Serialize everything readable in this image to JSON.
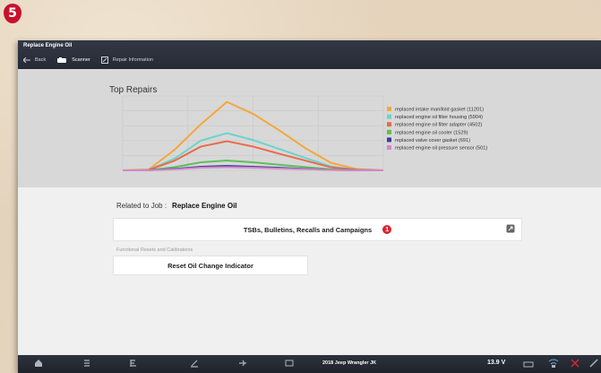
{
  "step_badge": "5",
  "window_title": "Replace Engine Oil",
  "nav": {
    "back_label": "Back",
    "scanner_label": "Scanner",
    "repair_info_label": "Repair Information"
  },
  "chart_data": {
    "type": "line",
    "title": "Top Repairs",
    "x": [
      1,
      2,
      3,
      4,
      5,
      6,
      7,
      8,
      9,
      10,
      11
    ],
    "ylim": [
      0,
      2500
    ],
    "grid": true,
    "legend_position": "right",
    "series": [
      {
        "name": "replaced intake manifold gasket (11201)",
        "color": "#f3a73b",
        "values": [
          0,
          30,
          700,
          1550,
          2300,
          1900,
          1350,
          750,
          250,
          40,
          0
        ]
      },
      {
        "name": "replaced engine oil filter housing (5904)",
        "color": "#6cd3cc",
        "values": [
          0,
          15,
          400,
          1000,
          1250,
          1020,
          720,
          420,
          130,
          20,
          0
        ]
      },
      {
        "name": "replaced engine oil filter adapter (4502)",
        "color": "#ea6a4a",
        "values": [
          0,
          12,
          330,
          800,
          980,
          800,
          560,
          330,
          100,
          15,
          0
        ]
      },
      {
        "name": "replaced engine oil cooler (1529)",
        "color": "#5fbf5a",
        "values": [
          0,
          5,
          110,
          270,
          330,
          270,
          190,
          110,
          35,
          5,
          0
        ]
      },
      {
        "name": "replaced valve cover gasket (691)",
        "color": "#3a3d9a",
        "values": [
          0,
          2,
          50,
          120,
          150,
          120,
          85,
          50,
          15,
          2,
          0
        ]
      },
      {
        "name": "replaced engine oil pressure sensor (501)",
        "color": "#d487c7",
        "values": [
          0,
          1,
          35,
          90,
          110,
          90,
          62,
          36,
          11,
          1,
          0
        ]
      }
    ]
  },
  "related": {
    "label": "Related to Job :",
    "job": "Replace Engine Oil"
  },
  "tsb_button": {
    "label": "TSBs, Bulletins, Recalls and Campaigns",
    "badge": "1"
  },
  "functional_section_label": "Functional Resets and Calibrations",
  "reset_button_label": "Reset Oil Change Indicator",
  "bottom": {
    "vehicle": "2018 Jeep Wrangler JK",
    "voltage": "13.9 V"
  }
}
